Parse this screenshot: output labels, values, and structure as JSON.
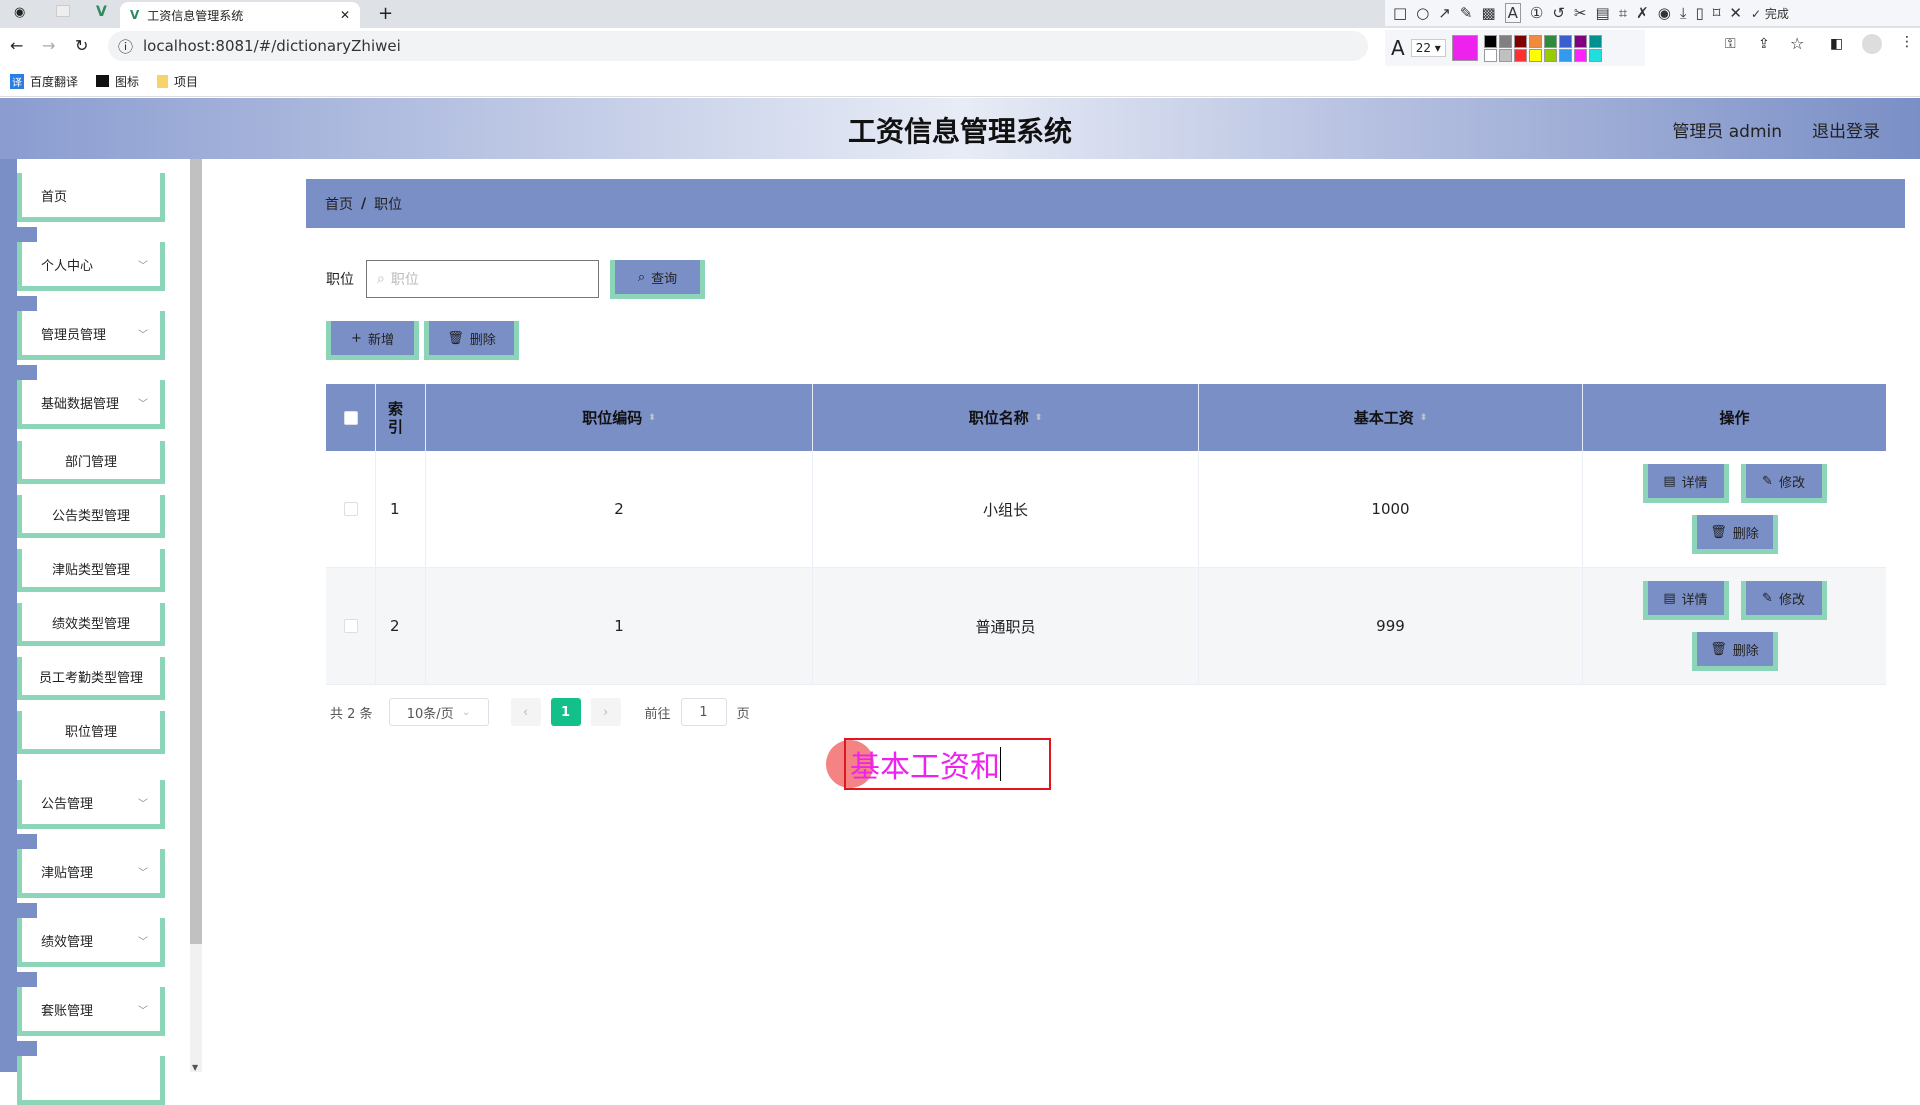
{
  "browser": {
    "tab_title": "工资信息管理系统",
    "url": "localhost:8081/#/dictionaryZhiwei",
    "bookmarks": [
      "百度翻译",
      "图标",
      "项目"
    ],
    "font_size": "22",
    "done_label": "完成"
  },
  "palette": [
    "#000000",
    "#808080",
    "#800000",
    "#f08a3c",
    "#2e8b3a",
    "#3a5fcd",
    "#800080",
    "#009090",
    "#ffffff",
    "#c0c0c0",
    "#ff3030",
    "#ffff00",
    "#99cc00",
    "#3399ee",
    "#ff22ff",
    "#22dddd"
  ],
  "current_color": "#ee22ee",
  "header": {
    "title": "工资信息管理系统",
    "user": "管理员 admin",
    "logout": "退出登录"
  },
  "sidebar": {
    "items": [
      {
        "label": "首页",
        "type": "top"
      },
      {
        "label": "个人中心",
        "type": "top",
        "chev": true
      },
      {
        "label": "管理员管理",
        "type": "top",
        "chev": true
      },
      {
        "label": "基础数据管理",
        "type": "top",
        "chev": true
      },
      {
        "label": "部门管理",
        "type": "sub"
      },
      {
        "label": "公告类型管理",
        "type": "sub"
      },
      {
        "label": "津贴类型管理",
        "type": "sub"
      },
      {
        "label": "绩效类型管理",
        "type": "sub"
      },
      {
        "label": "员工考勤类型管理",
        "type": "sub"
      },
      {
        "label": "职位管理",
        "type": "sub"
      },
      {
        "label": "公告管理",
        "type": "top",
        "chev": true
      },
      {
        "label": "津贴管理",
        "type": "top",
        "chev": true
      },
      {
        "label": "绩效管理",
        "type": "top",
        "chev": true
      },
      {
        "label": "套账管理",
        "type": "top",
        "chev": true
      }
    ]
  },
  "breadcrumb": {
    "home": "首页",
    "sep": "/",
    "current": "职位"
  },
  "search": {
    "label": "职位",
    "placeholder": "职位",
    "button": "查询"
  },
  "actions": {
    "add": "新增",
    "delete": "删除"
  },
  "table": {
    "headers": [
      "索引",
      "职位编码",
      "职位名称",
      "基本工资",
      "操作"
    ],
    "rows": [
      {
        "index": "1",
        "code": "2",
        "name": "小组长",
        "salary": "1000"
      },
      {
        "index": "2",
        "code": "1",
        "name": "普通职员",
        "salary": "999"
      }
    ],
    "op_labels": {
      "detail": "详情",
      "edit": "修改",
      "delete": "删除"
    }
  },
  "pagination": {
    "total": "共 2 条",
    "page_size": "10条/页",
    "current": "1",
    "goto_label": "前往",
    "goto_value": "1",
    "page_suffix": "页"
  },
  "annotation": {
    "text": "基本工资和"
  }
}
